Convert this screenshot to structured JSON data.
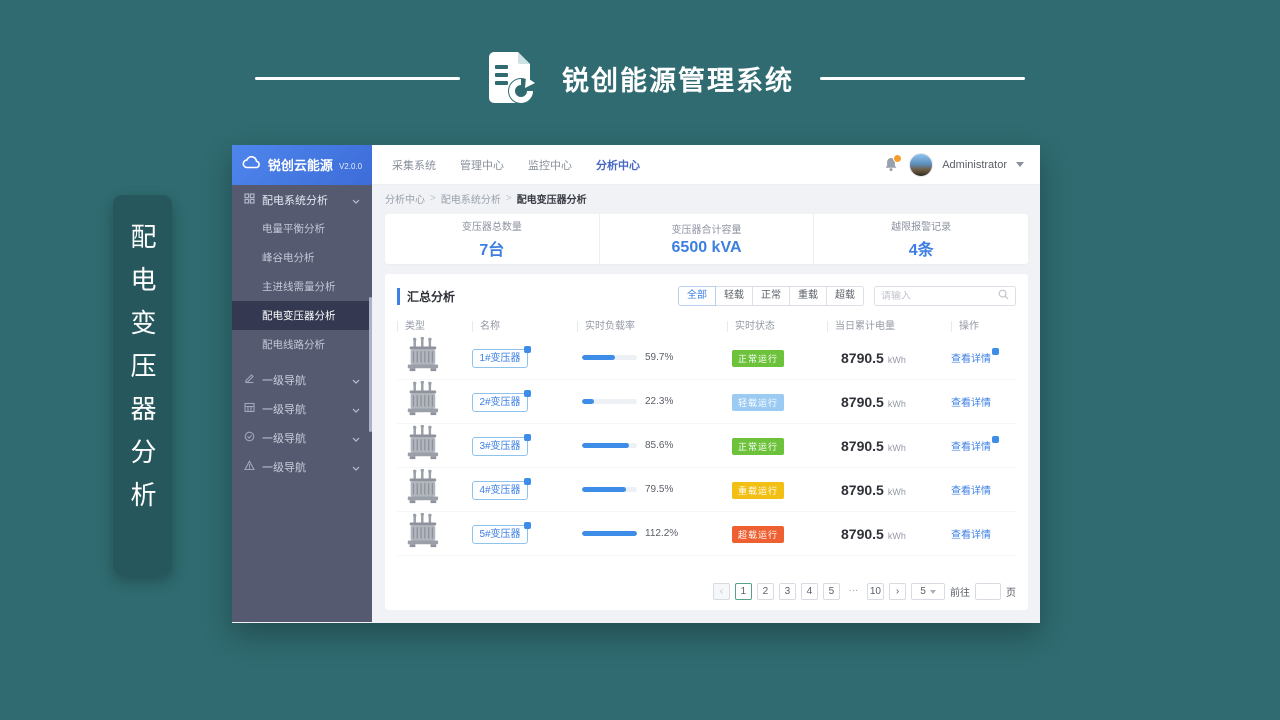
{
  "brand": {
    "title": "锐创能源管理系统"
  },
  "ribbon": {
    "title": "配电变压器分析"
  },
  "topbar": {
    "logo_name": "锐创云能源",
    "logo_version": "V2.0.0",
    "menu": [
      {
        "label": "采集系统"
      },
      {
        "label": "管理中心"
      },
      {
        "label": "监控中心"
      },
      {
        "label": "分析中心"
      }
    ],
    "active_menu": "分析中心",
    "user_name": "Administrator"
  },
  "sidebar": {
    "group_label": "配电系统分析",
    "children": [
      {
        "label": "电量平衡分析"
      },
      {
        "label": "峰谷电分析"
      },
      {
        "label": "主进线需量分析"
      },
      {
        "label": "配电变压器分析",
        "active": true
      },
      {
        "label": "配电线路分析"
      }
    ],
    "nav_items": [
      {
        "label": "一级导航",
        "icon": "edit-icon"
      },
      {
        "label": "一级导航",
        "icon": "table-icon"
      },
      {
        "label": "一级导航",
        "icon": "check-circle-icon"
      },
      {
        "label": "一级导航",
        "icon": "warning-icon"
      }
    ]
  },
  "breadcrumb": {
    "separator": ">",
    "items": [
      {
        "label": "分析中心"
      },
      {
        "label": "配电系统分析"
      },
      {
        "label": "配电变压器分析"
      }
    ]
  },
  "stats": [
    {
      "label": "变压器总数量",
      "value": "7台"
    },
    {
      "label": "变压器合计容量",
      "value": "6500 kVA"
    },
    {
      "label": "越限报警记录",
      "value": "4条"
    }
  ],
  "panel": {
    "title": "汇总分析",
    "filters": [
      {
        "label": "全部",
        "active": true
      },
      {
        "label": "轻载"
      },
      {
        "label": "正常"
      },
      {
        "label": "重载"
      },
      {
        "label": "超载"
      }
    ],
    "search_placeholder": "请输入",
    "table": {
      "headers": [
        "类型",
        "名称",
        "实时负载率",
        "实时状态",
        "当日累计电量",
        "操作"
      ],
      "rows": [
        {
          "name": "1#变压器",
          "load": "59.7%",
          "bar_width": "60%",
          "status": "正常运行",
          "status_color": "#6CC23A",
          "energy": "8790.5",
          "energy_unit": "kWh",
          "action": "查看详情"
        },
        {
          "name": "2#变压器",
          "load": "22.3%",
          "bar_width": "22%",
          "status": "轻载运行",
          "status_color": "#9BCBF2",
          "energy": "8790.5",
          "energy_unit": "kWh",
          "action": "查看详情"
        },
        {
          "name": "3#变压器",
          "load": "85.6%",
          "bar_width": "86%",
          "status": "正常运行",
          "status_color": "#6CC23A",
          "energy": "8790.5",
          "energy_unit": "kWh",
          "action": "查看详情"
        },
        {
          "name": "4#变压器",
          "load": "79.5%",
          "bar_width": "80%",
          "status": "重载运行",
          "status_color": "#F2C014",
          "energy": "8790.5",
          "energy_unit": "kWh",
          "action": "查看详情"
        },
        {
          "name": "5#变压器",
          "load": "112.2%",
          "bar_width": "100%",
          "status": "超载运行",
          "status_color": "#EE5F31",
          "energy": "8790.5",
          "energy_unit": "kWh",
          "action": "查看详情"
        }
      ]
    },
    "pagination": {
      "prev": "‹",
      "next": "›",
      "pages": [
        "1",
        "2",
        "3",
        "4",
        "5",
        "···",
        "10"
      ],
      "active_page": "1",
      "page_size": "5",
      "goto_label": "前往",
      "page_unit": "页"
    }
  }
}
